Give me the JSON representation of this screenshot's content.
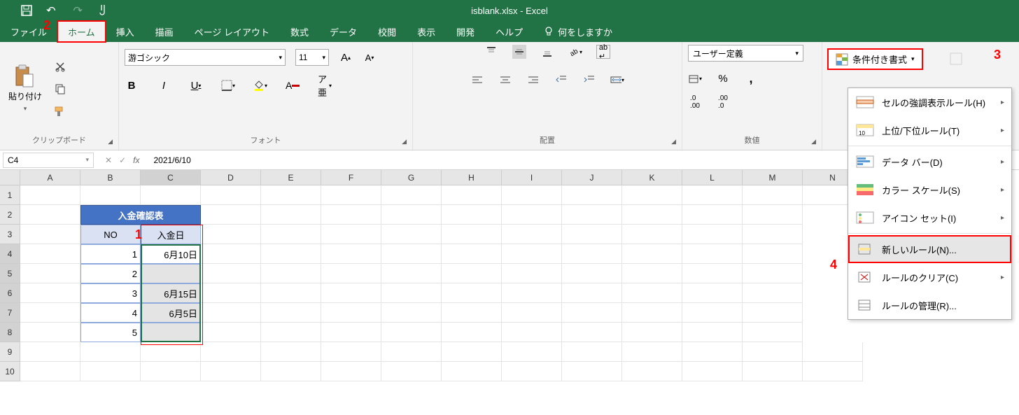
{
  "title": "isblank.xlsx  -  Excel",
  "annotations": {
    "a1": "1",
    "a2": "2",
    "a3": "3",
    "a4": "4"
  },
  "tabs": [
    "ファイル",
    "ホーム",
    "挿入",
    "描画",
    "ページ レイアウト",
    "数式",
    "データ",
    "校閲",
    "表示",
    "開発",
    "ヘルプ"
  ],
  "tellme": "何をしますか",
  "clipboard": {
    "paste": "貼り付け",
    "label": "クリップボード"
  },
  "font": {
    "name": "游ゴシック",
    "size": "11",
    "label": "フォント"
  },
  "alignment": {
    "label": "配置"
  },
  "number": {
    "format": "ユーザー定義",
    "label": "数値"
  },
  "styles": {
    "conditional": "条件付き書式"
  },
  "dropdown": {
    "highlight": "セルの強調表示ルール(H)",
    "top": "上位/下位ルール(T)",
    "databars": "データ バー(D)",
    "colorscales": "カラー スケール(S)",
    "iconsets": "アイコン セット(I)",
    "newrule": "新しいルール(N)...",
    "clear": "ルールのクリア(C)",
    "manage": "ルールの管理(R)..."
  },
  "namebox": "C4",
  "formula": "2021/6/10",
  "columns": [
    "A",
    "B",
    "C",
    "D",
    "E",
    "F",
    "G",
    "H",
    "I",
    "J",
    "K",
    "L",
    "M",
    "N"
  ],
  "rows": [
    "1",
    "2",
    "3",
    "4",
    "5",
    "6",
    "7",
    "8",
    "9",
    "10"
  ],
  "table": {
    "title": "入金確認表",
    "h1": "NO",
    "h2": "入金日",
    "r1c1": "1",
    "r1c2": "6月10日",
    "r2c1": "2",
    "r2c2": "",
    "r3c1": "3",
    "r3c2": "6月15日",
    "r4c1": "4",
    "r4c2": "6月5日",
    "r5c1": "5",
    "r5c2": ""
  }
}
